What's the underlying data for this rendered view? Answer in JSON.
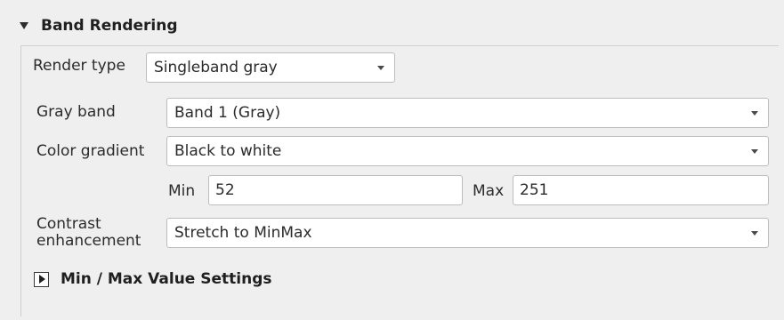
{
  "section": {
    "title": "Band Rendering"
  },
  "render_type": {
    "label": "Render type",
    "value": "Singleband gray"
  },
  "gray_band": {
    "label": "Gray band",
    "value": "Band 1 (Gray)"
  },
  "color_gradient": {
    "label": "Color gradient",
    "value": "Black to white"
  },
  "min": {
    "label": "Min",
    "value": "52"
  },
  "max": {
    "label": "Max",
    "value": "251"
  },
  "contrast": {
    "label_line1": "Contrast",
    "label_line2": "enhancement",
    "value": "Stretch to MinMax"
  },
  "minmax_settings": {
    "title": "Min / Max Value Settings"
  }
}
